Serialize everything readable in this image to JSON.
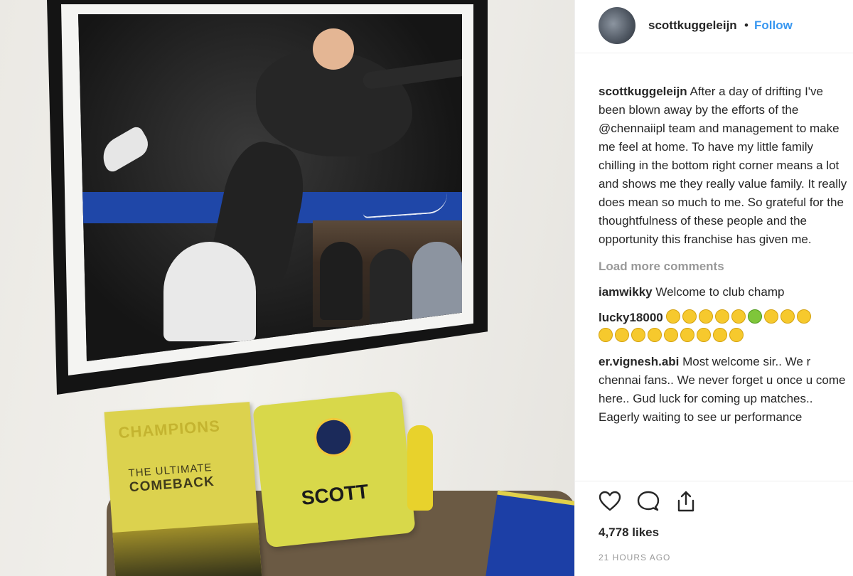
{
  "post": {
    "username": "scottkuggeleijn",
    "separator": "•",
    "follow_label": "Follow",
    "caption_user": "scottkuggeleijn",
    "caption_text": "After a day of drifting I've been blown away by the efforts of the @chennaiipl team and management to make me feel at home. To have my little family chilling in the bottom right corner means a lot and shows me they really value family. It really does mean so much to me. So grateful for the thoughtfulness of these people and the opportunity this franchise has given me.",
    "load_more_label": "Load more comments",
    "comments": [
      {
        "user": "iamwikky",
        "text": "Welcome to club champ"
      },
      {
        "user": "lucky18000",
        "text": ""
      },
      {
        "user": "er.vignesh.abi",
        "text": "Most welcome sir.. We r chennai fans.. We never forget u once u come here.. Gud luck for coming up matches.. Eagerly waiting to see ur performance"
      }
    ],
    "likes": "4,778 likes",
    "timestamp": "21 HOURS AGO"
  },
  "photo": {
    "book_title": "CHAMPIONS",
    "book_subtitle_1": "THE ULTIMATE",
    "book_subtitle_2": "COMEBACK",
    "pillow_name": "SCOTT"
  },
  "icons": [
    "heart-icon",
    "comment-icon",
    "share-icon"
  ],
  "colors": {
    "follow": "#3897f0",
    "muted": "#999999",
    "text": "#262626"
  }
}
